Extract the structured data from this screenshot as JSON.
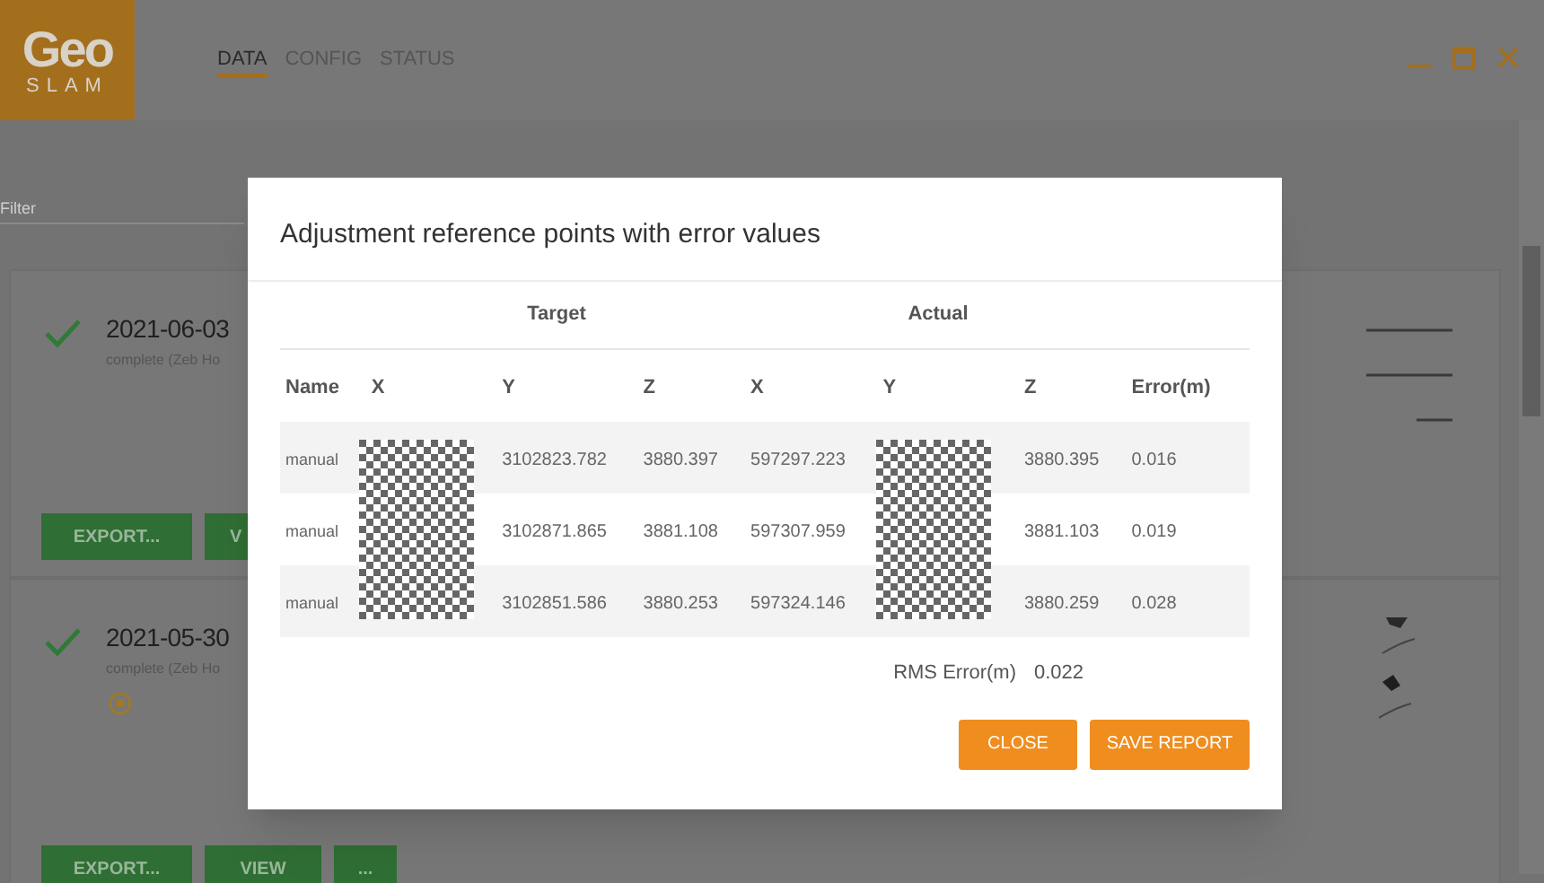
{
  "logo": {
    "top": "Geo",
    "bottom": "SLAM"
  },
  "tabs": [
    {
      "label": "DATA",
      "selected": true
    },
    {
      "label": "CONFIG",
      "selected": false
    },
    {
      "label": "STATUS",
      "selected": false
    }
  ],
  "filter": {
    "placeholder": "Filter"
  },
  "scans": [
    {
      "title": "2021-06-03",
      "subtitle": "complete (Zeb Ho",
      "complete": true,
      "location_marker": false,
      "buttons": [
        "EXPORT...",
        "V"
      ]
    },
    {
      "title": "2021-05-30",
      "subtitle": "complete (Zeb Ho",
      "complete": true,
      "location_marker": true,
      "buttons": [
        "EXPORT...",
        "VIEW",
        "..."
      ]
    }
  ],
  "dialog": {
    "title": "Adjustment reference points with error values",
    "group_headers": [
      "Target",
      "Actual"
    ],
    "columns": [
      "Name",
      "X",
      "Y",
      "Z",
      "X",
      "Y",
      "Z",
      "Error(m)"
    ],
    "rows": [
      {
        "cells": [
          "manual",
          null,
          "3102823.782",
          "3880.397",
          "597297.223",
          null,
          "3880.395",
          "0.016"
        ]
      },
      {
        "cells": [
          "manual",
          null,
          "3102871.865",
          "3881.108",
          "597307.959",
          null,
          "3881.103",
          "0.019"
        ]
      },
      {
        "cells": [
          "manual",
          null,
          "3102851.586",
          "3880.253",
          "597324.146",
          null,
          "3880.259",
          "0.028"
        ]
      }
    ],
    "rms": {
      "label": "RMS Error(m)",
      "value": "0.022"
    },
    "buttons": [
      "CLOSE",
      "SAVE REPORT"
    ]
  }
}
